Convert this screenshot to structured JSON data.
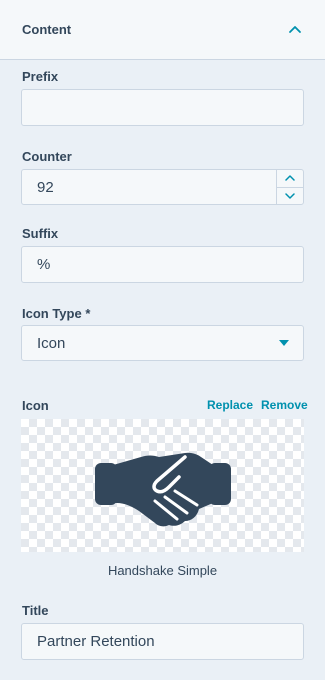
{
  "section": {
    "title": "Content"
  },
  "fields": {
    "prefix": {
      "label": "Prefix",
      "value": ""
    },
    "counter": {
      "label": "Counter",
      "value": "92"
    },
    "suffix": {
      "label": "Suffix",
      "value": "%"
    },
    "icon_type": {
      "label": "Icon Type *",
      "value": "Icon"
    },
    "icon": {
      "label": "Icon",
      "replace_label": "Replace",
      "remove_label": "Remove",
      "icon_name": "Handshake Simple"
    },
    "title": {
      "label": "Title",
      "value": "Partner Retention"
    }
  },
  "colors": {
    "accent": "#0091ae",
    "text": "#33475b",
    "icon": "#33475b",
    "background": "#eaf0f6"
  }
}
